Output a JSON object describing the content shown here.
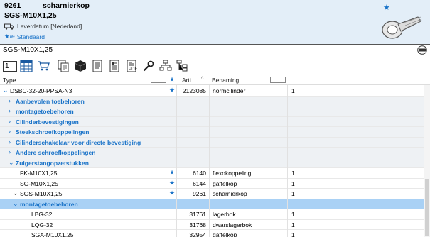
{
  "product": {
    "number": "9261",
    "description": "scharnierkop",
    "code": "SGS-M10X1,25",
    "delivery": "Leverdatum [Nederland]",
    "standard": "Standaard"
  },
  "search": {
    "value": "SGS-M10X1,25"
  },
  "toolbar": {
    "quantity": "1"
  },
  "table": {
    "columns": {
      "type": "Type",
      "article": "Arti...",
      "name": "Benaming",
      "qty": "..."
    },
    "rows": [
      {
        "kind": "item",
        "level": 0,
        "chevron": "v",
        "type": "DSBC-32-20-PPSA-N3",
        "star": true,
        "article": "2123085",
        "name": "normcilinder",
        "qty": "1"
      },
      {
        "kind": "group",
        "level": 1,
        "chevron": ">",
        "type": "Aanbevolen toebehoren"
      },
      {
        "kind": "group",
        "level": 1,
        "chevron": ">",
        "type": "montagetoebehoren"
      },
      {
        "kind": "group",
        "level": 1,
        "chevron": ">",
        "type": "Cilinderbevestigingen"
      },
      {
        "kind": "group",
        "level": 1,
        "chevron": ">",
        "type": "Steekschroefkoppelingen"
      },
      {
        "kind": "group",
        "level": 1,
        "chevron": ">",
        "type": "Cilinderschakelaar voor directe bevestiging"
      },
      {
        "kind": "group",
        "level": 1,
        "chevron": ">",
        "type": "Andere schroefkoppelingen"
      },
      {
        "kind": "group",
        "level": 1,
        "chevron": "v",
        "type": "Zuigerstangopzetstukken"
      },
      {
        "kind": "item",
        "level": 2,
        "chevron": "",
        "type": "FK-M10X1,25",
        "star": true,
        "article": "6140",
        "name": "flexokoppeling",
        "qty": "1"
      },
      {
        "kind": "item",
        "level": 2,
        "chevron": "",
        "type": "SG-M10X1,25",
        "star": true,
        "article": "6144",
        "name": "gaffelkop",
        "qty": "1"
      },
      {
        "kind": "item",
        "level": 2,
        "chevron": "v",
        "type": "SGS-M10X1,25",
        "star": true,
        "article": "9261",
        "name": "scharnierkop",
        "qty": "1"
      },
      {
        "kind": "selected",
        "level": 3,
        "chevron": "v",
        "type": "montagetoebehoren"
      },
      {
        "kind": "item",
        "level": 4,
        "chevron": "",
        "type": "LBG-32",
        "star": false,
        "article": "31761",
        "name": "lagerbok",
        "qty": "1"
      },
      {
        "kind": "item",
        "level": 4,
        "chevron": "",
        "type": "LQG-32",
        "star": false,
        "article": "31768",
        "name": "dwarslagerbok",
        "qty": "1"
      },
      {
        "kind": "item",
        "level": 4,
        "chevron": "",
        "type": "SGA-M10X1,25",
        "star": false,
        "article": "32954",
        "name": "gaffelkop",
        "qty": "1"
      }
    ]
  },
  "colors": {
    "accent": "#1a73c8",
    "header_bg": "#e3eef8",
    "group_bg": "#eef1f4",
    "selected_bg": "#a9d1f5"
  }
}
